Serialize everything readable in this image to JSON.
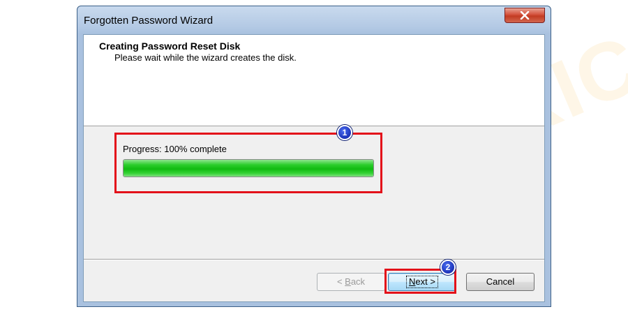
{
  "window": {
    "title": "Forgotten Password Wizard"
  },
  "header": {
    "title": "Creating Password Reset Disk",
    "subtitle": "Please wait while the wizard creates the disk."
  },
  "progress": {
    "label": "Progress: 100% complete",
    "value_percent": 100,
    "bar_color": "#1fc41f"
  },
  "buttons": {
    "back": {
      "prefix": "< ",
      "accel": "B",
      "rest": "ack",
      "enabled": false
    },
    "next": {
      "accel": "N",
      "rest": "ext >",
      "enabled": true,
      "default": true
    },
    "cancel": {
      "label": "Cancel",
      "enabled": true
    }
  },
  "annotations": {
    "step1": "1",
    "step2": "2",
    "highlight_color": "#e3111a"
  },
  "watermark": {
    "text": "DEVICETRICKS"
  },
  "icons": {
    "close": "close-x-icon"
  }
}
